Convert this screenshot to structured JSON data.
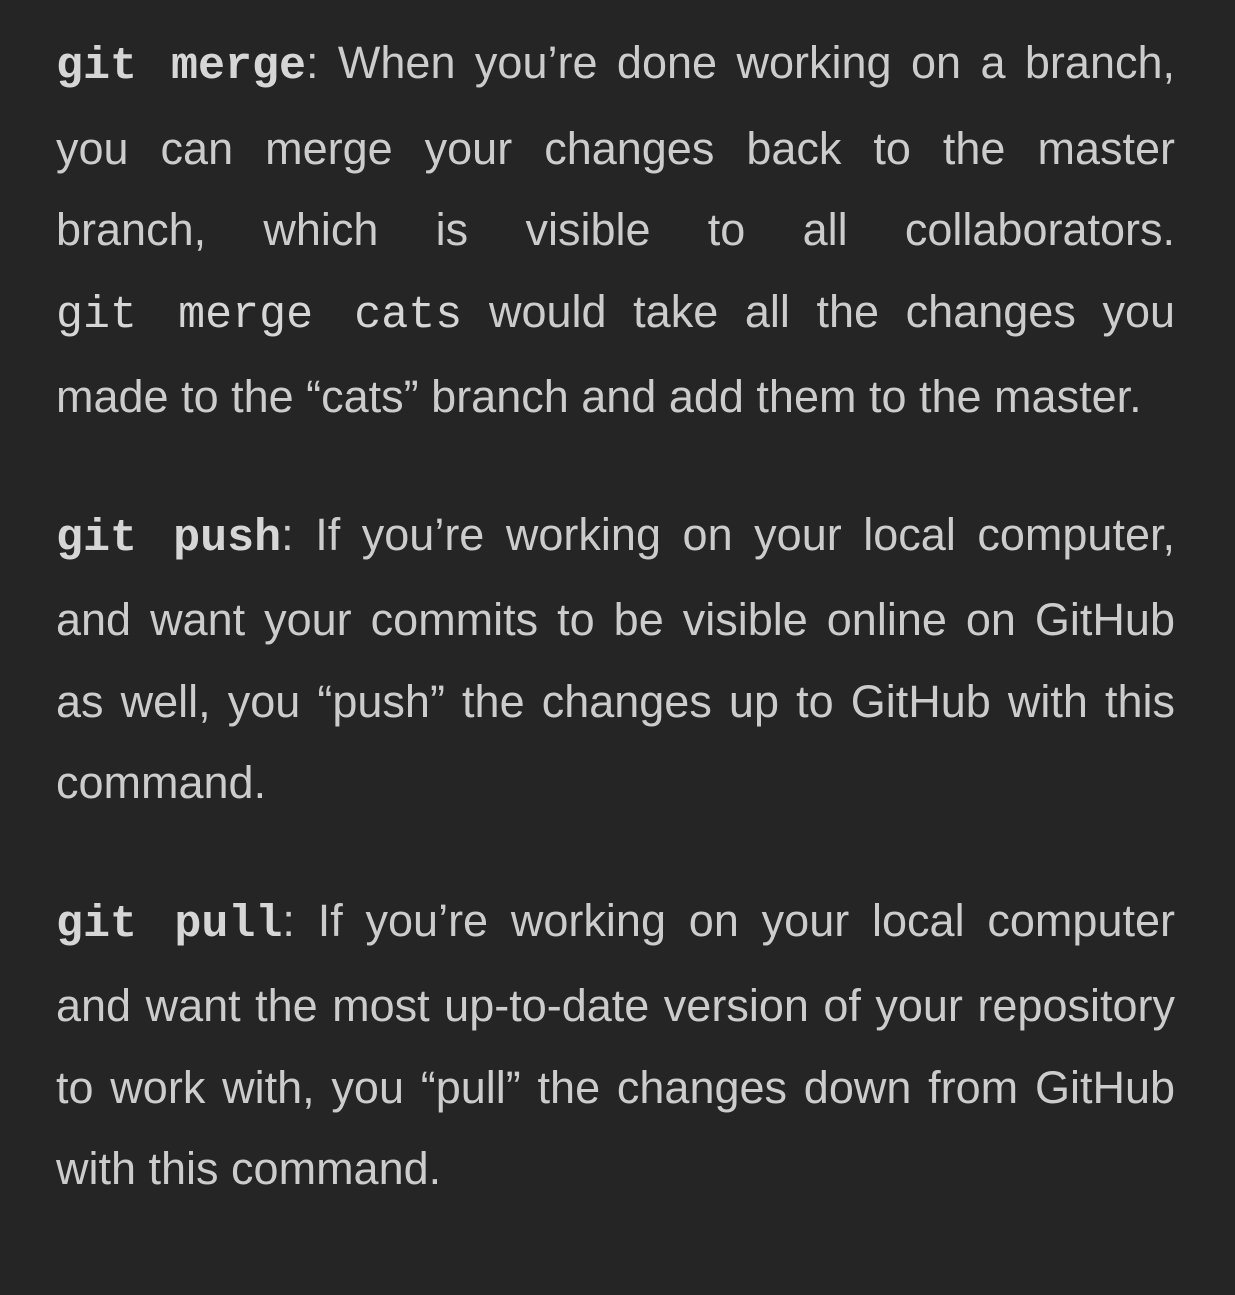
{
  "entries": [
    {
      "command": "git merge",
      "colon": ":",
      "text_before_code": " When you’re done working on a branch, you can merge your changes back to the master branch, which is visible to all collabora­tors. ",
      "inline_code": "git merge cats",
      "text_after_code": " would take all the changes you made to the “cats” branch and add them to the master."
    },
    {
      "command": "git push",
      "colon": ":",
      "text": " If you’re working on your local com­puter, and want your commits to be visible online on GitHub as well, you “push” the changes up to GitHub with this command."
    },
    {
      "command": "git pull",
      "colon": ":",
      "text": " If you’re working on your local com­puter and want the most up-to-date version of your repository to work with, you “pull” the changes down from GitHub with this command."
    }
  ]
}
